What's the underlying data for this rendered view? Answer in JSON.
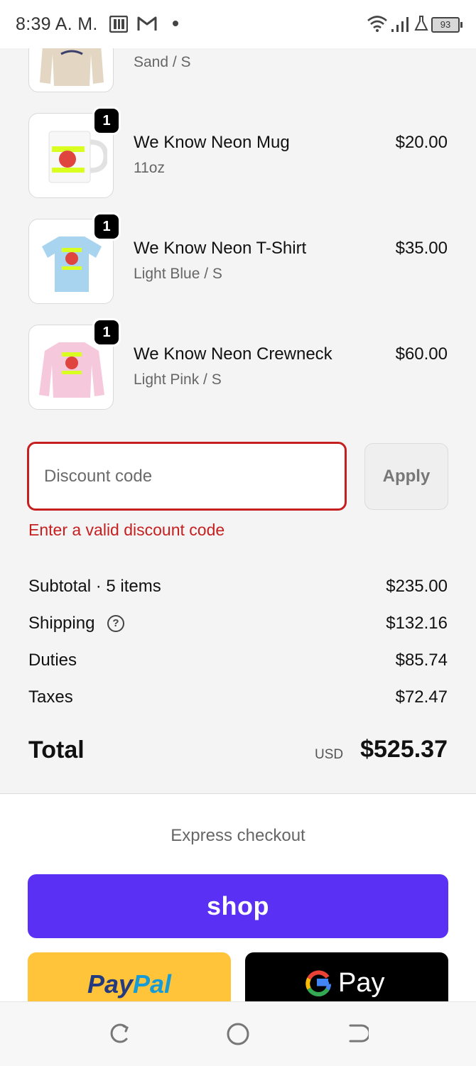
{
  "status_bar": {
    "time": "8:39 A. M.",
    "battery": "93",
    "icons": [
      "news-app-icon",
      "gmail-icon",
      "notification-dot",
      "wifi-icon",
      "signal-icon",
      "lab-icon",
      "battery-icon"
    ]
  },
  "cart": {
    "partial_item": {
      "variant": "Sand / S"
    },
    "items": [
      {
        "qty": "1",
        "name": "We Know Neon Mug",
        "variant": "11oz",
        "price": "$20.00"
      },
      {
        "qty": "1",
        "name": "We Know Neon T-Shirt",
        "variant": "Light Blue / S",
        "price": "$35.00"
      },
      {
        "qty": "1",
        "name": "We Know Neon Crewneck",
        "variant": "Light Pink / S",
        "price": "$60.00"
      }
    ]
  },
  "discount": {
    "placeholder": "Discount code",
    "value": "",
    "apply_label": "Apply",
    "error": "Enter a valid discount code"
  },
  "summary": {
    "subtotal_label": "Subtotal · 5 items",
    "subtotal_value": "$235.00",
    "shipping_label": "Shipping",
    "shipping_value": "$132.16",
    "duties_label": "Duties",
    "duties_value": "$85.74",
    "taxes_label": "Taxes",
    "taxes_value": "$72.47",
    "total_label": "Total",
    "currency": "USD",
    "total_value": "$525.37"
  },
  "express": {
    "title": "Express checkout",
    "shop_label": "shop",
    "paypal_part1": "Pay",
    "paypal_part2": "Pal",
    "gpay_label": "Pay"
  },
  "colors": {
    "error": "#c61f1f",
    "shop_purple": "#5a31f4",
    "paypal_yellow": "#ffc439",
    "gpay_black": "#000000"
  }
}
